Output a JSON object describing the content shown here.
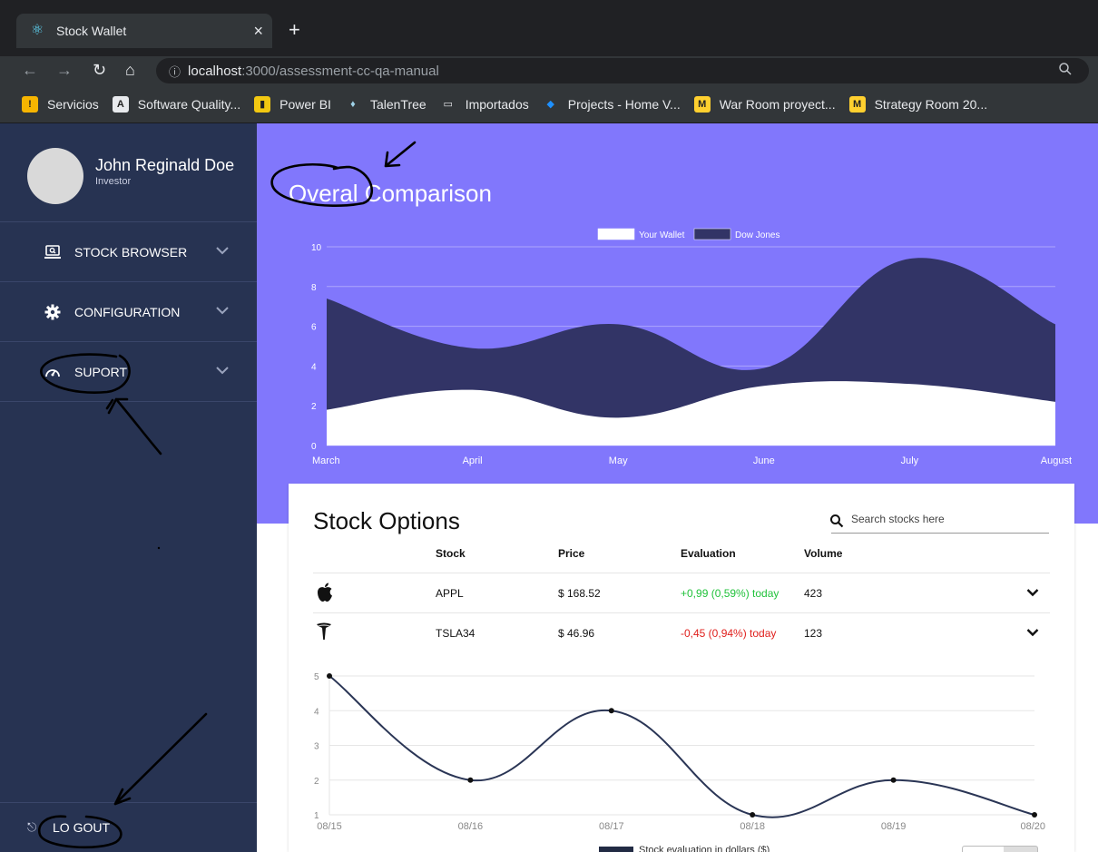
{
  "browser": {
    "tab_title": "Stock Wallet",
    "new_tab": "+",
    "url_host": "localhost",
    "url_path": ":3000/assessment-cc-qa-manual",
    "bookmarks": [
      {
        "label": "Servicios",
        "icon": "servicios-icon",
        "color": "#f7b500"
      },
      {
        "label": "Software Quality...",
        "icon": "letter-a-icon",
        "color": "#e8eaed"
      },
      {
        "label": "Power BI",
        "icon": "powerbi-icon",
        "color": "#f2c811"
      },
      {
        "label": "TalenTree",
        "icon": "talentree-icon",
        "color": "#9fd2e8"
      },
      {
        "label": "Importados",
        "icon": "folder-icon",
        "color": "#e8eaed"
      },
      {
        "label": "Projects - Home V...",
        "icon": "azure-devops-icon",
        "color": "#1e90ff"
      },
      {
        "label": "War Room proyect...",
        "icon": "miro-icon",
        "color": "#ffd02f"
      },
      {
        "label": "Strategy Room 20...",
        "icon": "miro-icon",
        "color": "#ffd02f"
      }
    ]
  },
  "sidebar": {
    "user_name": "John Reginald Doe",
    "user_role": "Investor",
    "items": [
      {
        "label": "STOCK BROWSER",
        "icon": "monitor-search-icon"
      },
      {
        "label": "CONFIGURATION",
        "icon": "gear-icon"
      },
      {
        "label": "SUPORT",
        "icon": "support-gauge-icon"
      }
    ],
    "logout_label": "LO GOUT"
  },
  "main": {
    "title": "Overal Comparison",
    "stock_options": {
      "title": "Stock Options",
      "search_placeholder": "Search stocks here",
      "columns": [
        "Stock",
        "Price",
        "Evaluation",
        "Volume"
      ],
      "rows": [
        {
          "logo": "apple-icon",
          "stock": "APPL",
          "price": "$ 168.52",
          "evaluation": "+0,99 (0,59%) today",
          "trend": "up",
          "volume": "423"
        },
        {
          "logo": "tesla-icon",
          "stock": "TSLA34",
          "price": "$ 46.96",
          "evaluation": "-0,45 (0,94%) today",
          "trend": "down",
          "volume": "123"
        }
      ]
    }
  },
  "colors": {
    "sidebar_bg": "#273352",
    "hero_bg": "#8177fc",
    "dow_fill": "#323466",
    "wallet_fill": "#ffffff",
    "positive": "#21c23b",
    "negative": "#e0201d",
    "annotation_ink": "#000000"
  },
  "chart_data": [
    {
      "type": "area",
      "categories": [
        "March",
        "April",
        "May",
        "June",
        "July",
        "August"
      ],
      "series": [
        {
          "name": "Your Wallet",
          "values": [
            1.8,
            2.8,
            1.4,
            3.0,
            3.1,
            2.2
          ]
        },
        {
          "name": "Dow Jones",
          "values": [
            7.4,
            4.9,
            6.1,
            3.9,
            9.4,
            6.1
          ]
        }
      ],
      "ylim": [
        0,
        10
      ],
      "yticks": [
        0,
        2,
        4,
        6,
        8,
        10
      ],
      "grid": true,
      "legend": "top-center"
    },
    {
      "type": "line",
      "categories": [
        "08/15",
        "08/16",
        "08/17",
        "08/18",
        "08/19",
        "08/20"
      ],
      "series": [
        {
          "name": "Stock evaluation in dollars ($)",
          "values": [
            5,
            2,
            4,
            1,
            2,
            1
          ]
        }
      ],
      "ylim": [
        1,
        5
      ],
      "yticks": [
        1,
        2,
        3,
        4,
        5
      ],
      "grid": true,
      "legend": "bottom"
    }
  ]
}
